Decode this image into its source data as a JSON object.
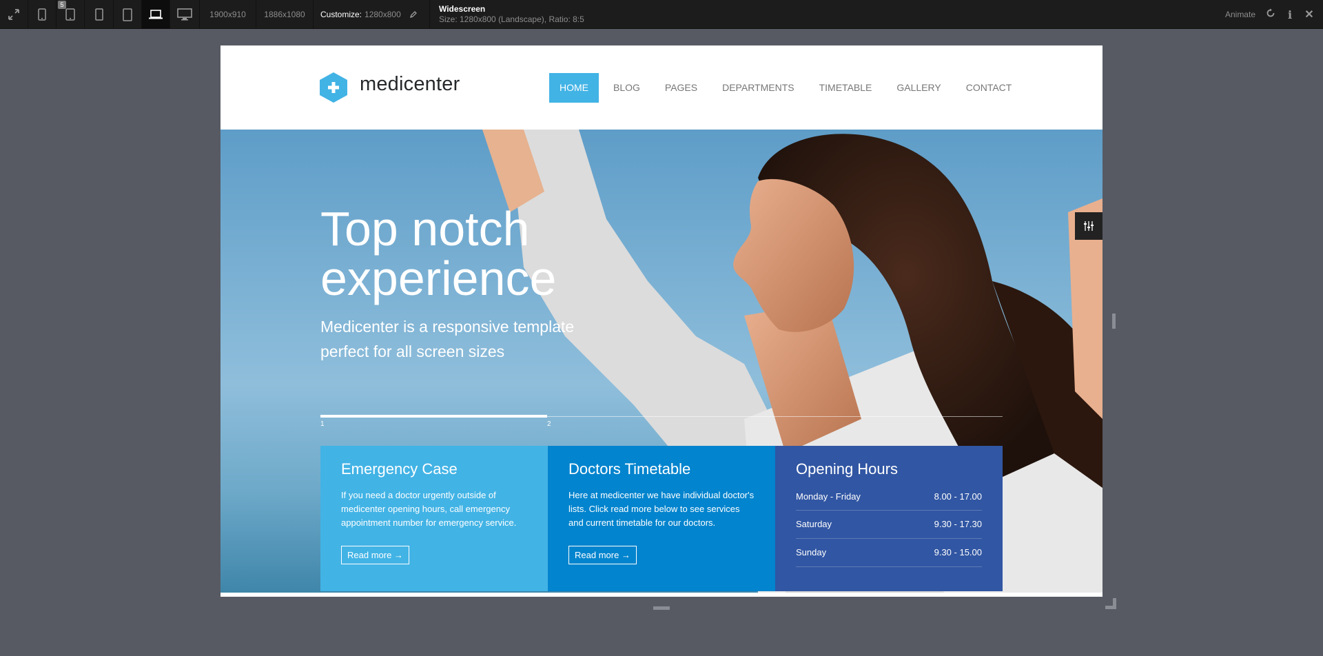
{
  "toolbar": {
    "device_badge": "5",
    "sizes": [
      "1900x910",
      "1886x1080"
    ],
    "customize_label": "Customize:",
    "customize_value": "1280x800",
    "info_title": "Widescreen",
    "info_sub": "Size: 1280x800 (Landscape), Ratio: 8:5",
    "animate_label": "Animate",
    "icons": [
      "fullscreen-icon",
      "phone-portrait-icon",
      "phone-landscape-icon",
      "small-tablet-icon",
      "tablet-icon",
      "laptop-icon",
      "desktop-icon",
      "pencil-icon",
      "refresh-icon",
      "info-icon",
      "close-icon"
    ]
  },
  "site": {
    "logo": "medicenter",
    "nav": [
      "HOME",
      "BLOG",
      "PAGES",
      "DEPARTMENTS",
      "TIMETABLE",
      "GALLERY",
      "CONTACT"
    ],
    "hero": {
      "title_line1": "Top notch",
      "title_line2": "experience",
      "subtitle": "Medicenter is a responsive template perfect for all screen sizes",
      "slides": [
        "1",
        "2"
      ]
    },
    "boxes": [
      {
        "title": "Emergency Case",
        "text": "If you need a doctor urgently outside of medicenter opening hours, call emergency appointment number for emergency service.",
        "button": "Read more →"
      },
      {
        "title": "Doctors Timetable",
        "text": "Here at medicenter we have individual doctor's lists. Click read more below to see services and current timetable for our doctors.",
        "button": "Read more →"
      },
      {
        "title": "Opening Hours",
        "hours": [
          {
            "day": "Monday - Friday",
            "time": "8.00 - 17.00"
          },
          {
            "day": "Saturday",
            "time": "9.30 - 17.30"
          },
          {
            "day": "Sunday",
            "time": "9.30 - 15.00"
          }
        ]
      }
    ],
    "colors": {
      "accent": "#42b3e5",
      "blue_mid": "#0384ce",
      "blue_dark": "#3156a3"
    }
  }
}
